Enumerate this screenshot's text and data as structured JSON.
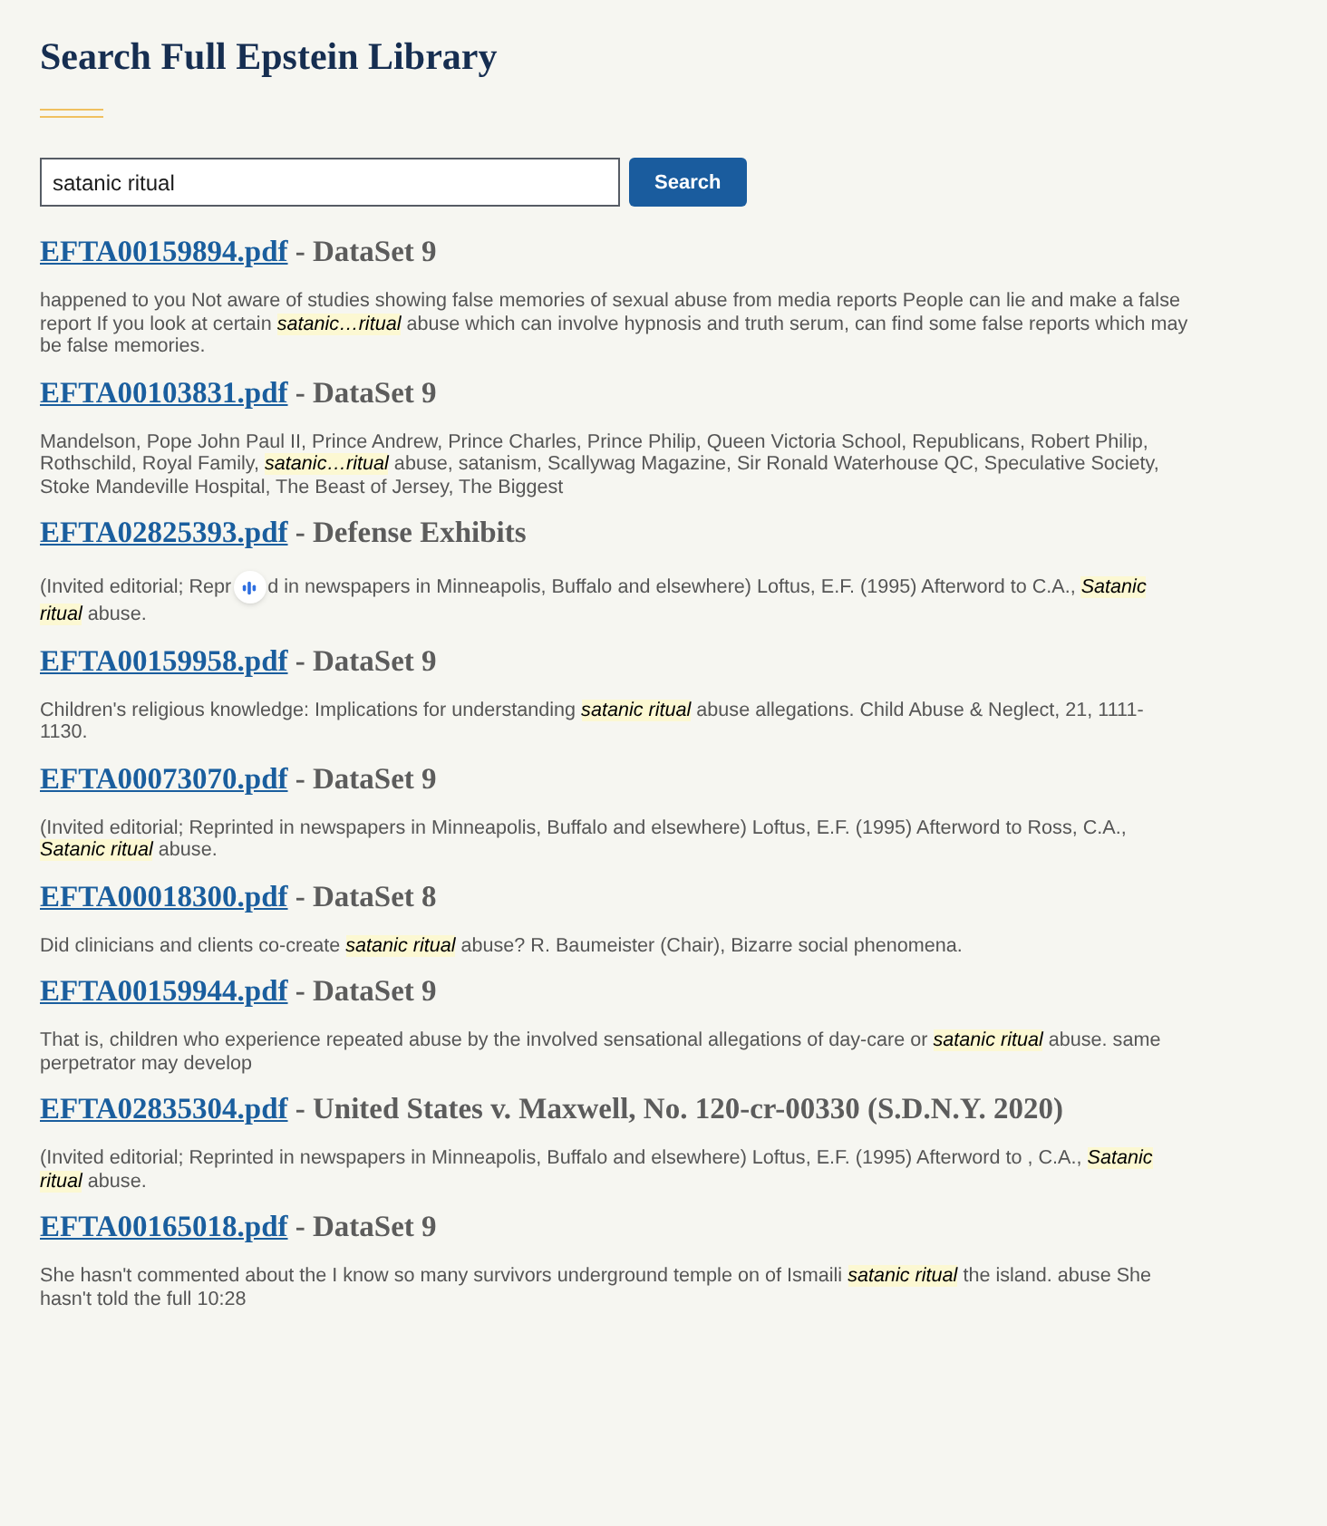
{
  "title": "Search Full Epstein Library",
  "search": {
    "value": "satanic ritual",
    "button": "Search"
  },
  "results": [
    {
      "file": "EFTA00159894.pdf",
      "source": "- DataSet 9",
      "snippet": "happened to you Not aware of studies showing false memories of sexual abuse from media reports People can lie and make a false report If you look at certain *satanic…ritual* abuse which can involve hypnosis and truth serum, can find some false reports which may be false memories."
    },
    {
      "file": "EFTA00103831.pdf",
      "source": "- DataSet 9",
      "snippet": "Mandelson, Pope John Paul II, Prince Andrew, Prince Charles, Prince Philip, Queen Victoria School, Republicans, Robert Philip, Rothschild, Royal Family, *satanic…ritual* abuse, satanism, Scallywag Magazine, Sir Ronald Waterhouse QC, Speculative Society, Stoke Mandeville Hospital, The Beast of Jersey, The Biggest"
    },
    {
      "file": "EFTA02825393.pdf",
      "source": "- Defense Exhibits",
      "snippet_parts": [
        "(Invited editorial; Repr",
        "d in newspapers in Minneapolis, Buffalo and elsewhere) Loftus, E.F. (1995) Afterword to C.A., *Satanic*",
        "*ritual* abuse."
      ]
    },
    {
      "file": "EFTA00159958.pdf",
      "source": "- DataSet 9",
      "snippet": "Children's religious knowledge: Implications for understanding *satanic ritual* abuse allegations. Child Abuse & Neglect, 21, 1111-1130."
    },
    {
      "file": "EFTA00073070.pdf",
      "source": "- DataSet 9",
      "snippet": "(Invited editorial; Reprinted in newspapers in Minneapolis, Buffalo and elsewhere) Loftus, E.F. (1995) Afterword to Ross, C.A., *Satanic ritual* abuse."
    },
    {
      "file": "EFTA00018300.pdf",
      "source": "- DataSet 8",
      "snippet": "Did clinicians and clients co-create *satanic ritual* abuse? R. Baumeister (Chair), Bizarre social phenomena."
    },
    {
      "file": "EFTA00159944.pdf",
      "source": "- DataSet 9",
      "snippet": "That is, children who experience repeated abuse by the involved sensational allegations of day-care or *satanic ritual* abuse. same perpetrator may develop"
    },
    {
      "file": "EFTA02835304.pdf",
      "source": "- United States v. Maxwell, No. 120-cr-00330 (S.D.N.Y. 2020)",
      "snippet": "(Invited editorial; Reprinted in newspapers in Minneapolis, Buffalo and elsewhere) Loftus, E.F. (1995) Afterword to , C.A., *Satanic ritual* abuse."
    },
    {
      "file": "EFTA00165018.pdf",
      "source": "- DataSet 9",
      "snippet": "She hasn't commented about the I know so many survivors underground temple on of Ismaili *satanic ritual* the island. abuse She hasn't told the full 10:28"
    }
  ]
}
